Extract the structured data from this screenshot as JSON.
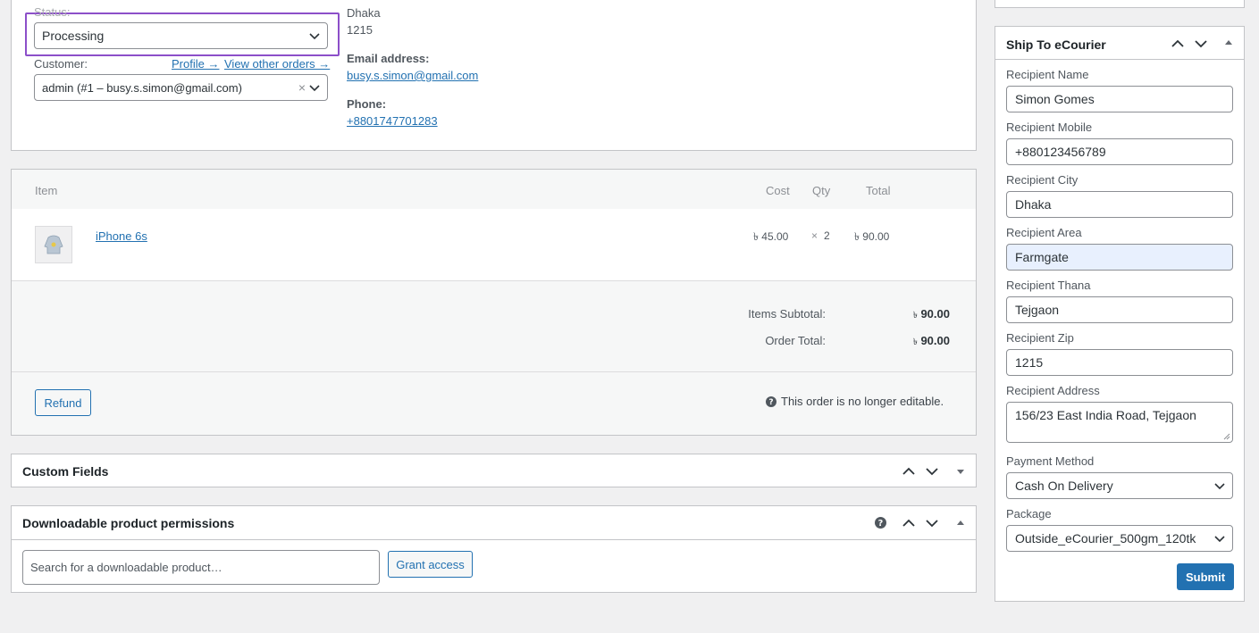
{
  "general": {
    "status_label": "Status:",
    "status_value": "Processing",
    "customer_label": "Customer:",
    "profile_link": "Profile →",
    "view_orders_link": "View other orders →",
    "customer_value": "admin (#1 – busy.s.simon@gmail.com)",
    "clear_symbol": "×"
  },
  "billing": {
    "city": "Dhaka",
    "zip": "1215",
    "email_label": "Email address:",
    "email": "busy.s.simon@gmail.com",
    "phone_label": "Phone:",
    "phone": "+8801747701283"
  },
  "items": {
    "header_item": "Item",
    "header_cost": "Cost",
    "header_qty": "Qty",
    "header_total": "Total",
    "rows": [
      {
        "name": "iPhone 6s",
        "cost": "৳ 45.00",
        "qty_symbol": "×",
        "qty": "2",
        "total": "৳ 90.00"
      }
    ],
    "subtotal_label": "Items Subtotal:",
    "subtotal_value": "90.00",
    "order_total_label": "Order Total:",
    "order_total_value": "90.00",
    "currency": "৳",
    "refund_label": "Refund",
    "not_editable": "This order is no longer editable."
  },
  "custom_fields": {
    "title": "Custom Fields"
  },
  "downloads": {
    "title": "Downloadable product permissions",
    "search_placeholder": "Search for a downloadable product…",
    "grant_label": "Grant access"
  },
  "ecourier": {
    "title": "Ship To eCourier",
    "recipient_name_label": "Recipient Name",
    "recipient_name": "Simon Gomes",
    "recipient_mobile_label": "Recipient Mobile",
    "recipient_mobile": "+880123456789",
    "recipient_city_label": "Recipient City",
    "recipient_city": "Dhaka",
    "recipient_area_label": "Recipient Area",
    "recipient_area": "Farmgate",
    "recipient_thana_label": "Recipient Thana",
    "recipient_thana": "Tejgaon",
    "recipient_zip_label": "Recipient Zip",
    "recipient_zip": "1215",
    "recipient_address_label": "Recipient Address",
    "recipient_address": "156/23 East India Road, Tejgaon",
    "payment_method_label": "Payment Method",
    "payment_method": "Cash On Delivery",
    "package_label": "Package",
    "package": "Outside_eCourier_500gm_120tk",
    "submit_label": "Submit"
  },
  "colors": {
    "accent": "#2271b1",
    "focus_outline": "#8c4fc9",
    "autofill_bg": "#e8f0fe"
  }
}
